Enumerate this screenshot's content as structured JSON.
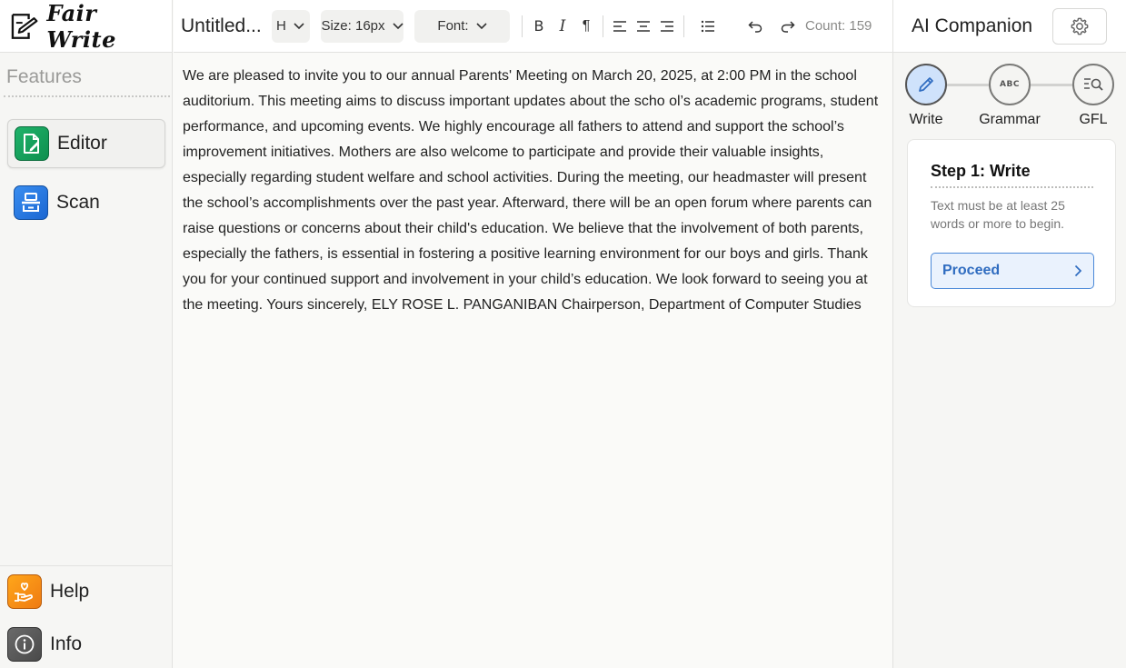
{
  "app": {
    "brand": "Fair Write"
  },
  "sidebar": {
    "section_title": "Features",
    "items": [
      {
        "label": "Editor",
        "icon": "document-edit-icon",
        "active": true
      },
      {
        "label": "Scan",
        "icon": "scanner-icon",
        "active": false
      }
    ],
    "bottom_items": [
      {
        "label": "Help",
        "icon": "hand-heart-icon"
      },
      {
        "label": "Info",
        "icon": "info-icon"
      }
    ]
  },
  "toolbar": {
    "doc_title": "Untitled...",
    "heading_select": "H",
    "size_select": "Size: 16px",
    "font_select": "Font:",
    "bold": "B",
    "italic": "I",
    "paragraph": "¶",
    "count_text": "Count: 159"
  },
  "editor": {
    "content": "We are pleased to invite you to our annual Parents' Meeting on March 20, 2025, at 2:00 PM in the school auditorium. This meeting aims to discuss important updates about the scho ol’s academic programs, student performance, and upcoming events. We highly encourage all fathers to attend and support the school’s improvement initiatives. Mothers are also welcome to participate and provide their valuable insights, especially regarding student welfare and school activities. During the meeting, our headmaster will present the school’s accomplishments over the past year. Afterward, there will be an open forum where parents can raise questions or concerns about their child's education. We believe that the involvement of both parents, especially the fathers, is essential in fostering a positive learning environment for our boys and girls. Thank you for your continued support and involvement in your child’s education. We look forward to seeing you at the meeting. Yours sincerely, ELY ROSE L. PANGANIBAN Chairperson, Department of Computer Studies"
  },
  "panel": {
    "title": "AI Companion",
    "steps": [
      {
        "label": "Write",
        "icon": "pencil-icon",
        "active": true
      },
      {
        "label": "Grammar",
        "icon": "abc-icon",
        "active": false
      },
      {
        "label": "GFL",
        "icon": "search-list-icon",
        "active": false
      }
    ],
    "card": {
      "title": "Step 1: Write",
      "description": "Text must be at least 25 words or more to begin.",
      "button_label": "Proceed"
    }
  },
  "colors": {
    "accent_blue": "#2f6cc0",
    "step_active_bg": "#cfe2fb",
    "editor_icon_green": "#1fb36a",
    "scan_icon_blue": "#1a66d2",
    "help_icon_orange": "#ef7b12"
  }
}
